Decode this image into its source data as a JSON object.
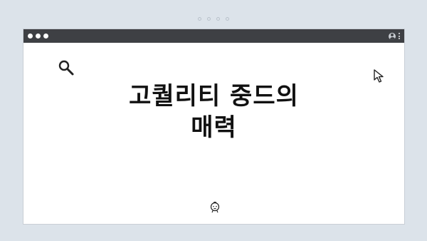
{
  "pager": {
    "dots": 4
  },
  "window": {
    "titlebar": {
      "controls": [
        "close",
        "minimize",
        "maximize"
      ],
      "right_icons": [
        "user-icon",
        "more-vertical-icon"
      ]
    }
  },
  "content": {
    "headline_line1": "고퀄리티 중드의",
    "headline_line2": "매력",
    "icons": [
      "search-icon",
      "cursor-icon",
      "baby-icon"
    ]
  },
  "colors": {
    "background": "#dce3ea",
    "titlebar": "#3e4044",
    "window": "#ffffff",
    "text": "#111111"
  }
}
